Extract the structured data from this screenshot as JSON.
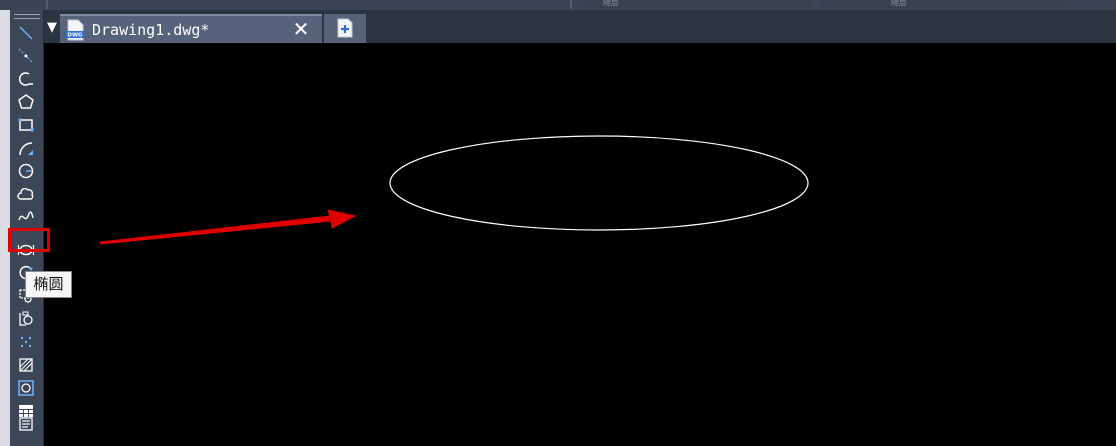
{
  "top_strip": {
    "fields": [
      "随层",
      "随层"
    ]
  },
  "left_toolbar": {
    "tools": [
      {
        "name": "line-icon"
      },
      {
        "name": "construction-line-icon"
      },
      {
        "name": "polyline-arc-icon"
      },
      {
        "name": "polygon-icon"
      },
      {
        "name": "rectangle-icon"
      },
      {
        "name": "arc-icon"
      },
      {
        "name": "circle-icon"
      },
      {
        "name": "revision-cloud-icon"
      },
      {
        "name": "spline-icon"
      },
      {
        "name": "ellipse-icon"
      },
      {
        "name": "ellipse-arc-icon"
      },
      {
        "name": "insert-block-icon"
      },
      {
        "name": "make-block-icon"
      },
      {
        "name": "point-icon"
      },
      {
        "name": "hatch-icon"
      },
      {
        "name": "region-icon"
      },
      {
        "name": "table-icon"
      },
      {
        "name": "multiline-text-icon"
      }
    ],
    "tooltip": "椭圆"
  },
  "tabs": {
    "active_title": "Drawing1.dwg*",
    "close_symbol": "✕",
    "file_icon_label": "DWG",
    "menu_symbol": "▼"
  },
  "colors": {
    "canvas": "#000000",
    "tab_active": "#56637a",
    "highlight": "#e00000",
    "arrow": "#e00000",
    "ellipse_stroke": "#ffffff"
  }
}
